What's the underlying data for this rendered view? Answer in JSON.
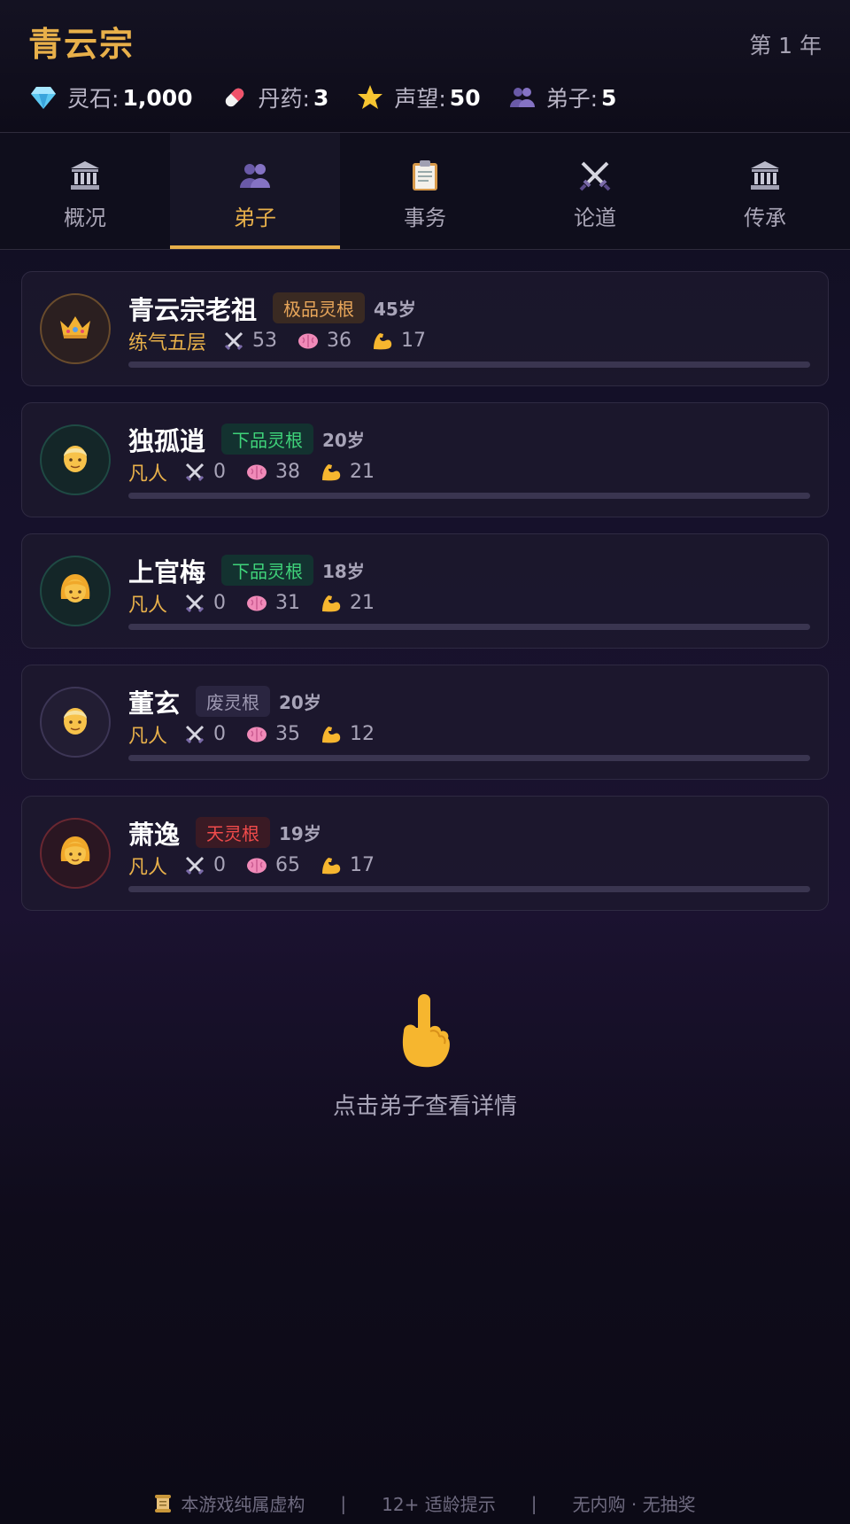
{
  "header": {
    "sect_name": "青云宗",
    "year": "第 1 年",
    "stats": [
      {
        "icon": "gem-icon",
        "label": "灵石:",
        "value": "1,000"
      },
      {
        "icon": "pill-icon",
        "label": "丹药:",
        "value": "3"
      },
      {
        "icon": "star-icon",
        "label": "声望:",
        "value": "50"
      },
      {
        "icon": "people-icon",
        "label": "弟子:",
        "value": "5"
      }
    ]
  },
  "tabs": [
    {
      "label": "概况",
      "icon": "temple-icon",
      "active": false
    },
    {
      "label": "弟子",
      "icon": "people-icon",
      "active": true
    },
    {
      "label": "事务",
      "icon": "clipboard-icon",
      "active": false
    },
    {
      "label": "论道",
      "icon": "crossed-swords-icon",
      "active": false
    },
    {
      "label": "传承",
      "icon": "temple-icon",
      "active": false
    }
  ],
  "disciples": [
    {
      "name": "青云宗老祖",
      "root": "极品灵根",
      "age": "45岁",
      "realm": "练气五层",
      "attack": "53",
      "wisdom": "36",
      "strength": "17",
      "avatar": "crown-icon",
      "progress": 0
    },
    {
      "name": "独孤逍",
      "root": "下品灵根",
      "age": "20岁",
      "realm": "凡人",
      "attack": "0",
      "wisdom": "38",
      "strength": "21",
      "avatar": "person-icon",
      "progress": 0
    },
    {
      "name": "上官梅",
      "root": "下品灵根",
      "age": "18岁",
      "realm": "凡人",
      "attack": "0",
      "wisdom": "31",
      "strength": "21",
      "avatar": "woman-icon",
      "progress": 0
    },
    {
      "name": "董玄",
      "root": "废灵根",
      "age": "20岁",
      "realm": "凡人",
      "attack": "0",
      "wisdom": "35",
      "strength": "12",
      "avatar": "person-icon",
      "progress": 0
    },
    {
      "name": "萧逸",
      "root": "天灵根",
      "age": "19岁",
      "realm": "凡人",
      "attack": "0",
      "wisdom": "65",
      "strength": "17",
      "avatar": "woman-icon",
      "progress": 0
    }
  ],
  "hint": {
    "icon": "pointing-hand-icon",
    "text": "点击弟子查看详情"
  },
  "footer": {
    "icon": "scroll-icon",
    "items": [
      "本游戏纯属虚构",
      "|",
      "12+ 适龄提示",
      "|",
      "无内购 · 无抽奖"
    ]
  },
  "colors": {
    "accent": "#e8b04a",
    "background": "#15112a"
  }
}
